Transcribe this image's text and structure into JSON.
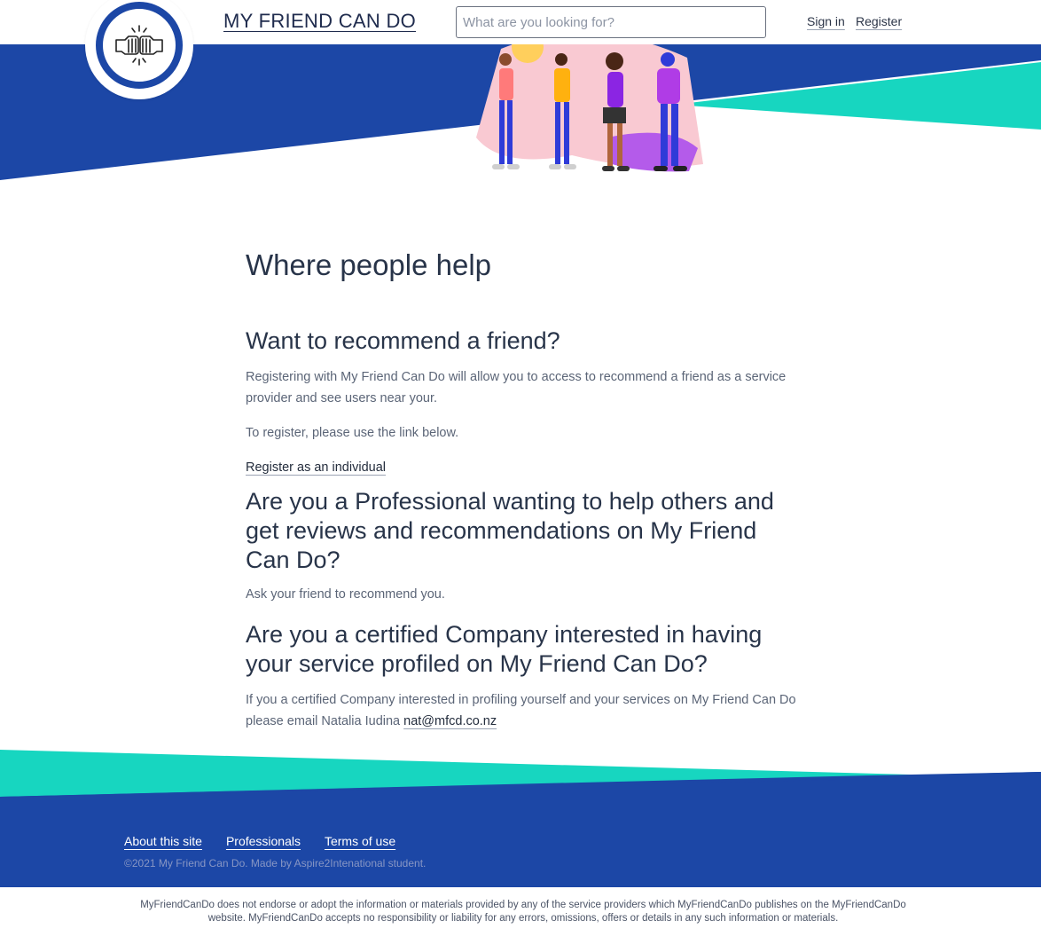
{
  "header": {
    "site_title": "MY FRIEND CAN DO",
    "search_placeholder": "What are you looking for?",
    "sign_in": "Sign in",
    "register": "Register"
  },
  "main": {
    "heading": "Where people help",
    "recommend": {
      "title": "Want to recommend a friend?",
      "paragraph_1": "Registering with My Friend Can Do will allow you to access to recommend a friend as a service provider and see users near your.",
      "paragraph_2": "To register, please use the link below.",
      "link": "Register as an individual"
    },
    "professional": {
      "title": "Are you a Professional wanting to help others and get reviews and recommendations on My Friend Can Do?",
      "paragraph": "Ask your friend to recommend you."
    },
    "company": {
      "title": "Are you a certified Company interested in having your service profiled on My Friend Can Do?",
      "paragraph": "If you a certified Company interested in profiling yourself and your services on My Friend Can Do please email Natalia Iudina",
      "email": "nat@mfcd.co.nz"
    }
  },
  "footer": {
    "links": [
      "About this site",
      "Professionals",
      "Terms of use"
    ],
    "copyright": "©2021 My Friend Can Do. Made by Aspire2Intenational student.",
    "disclaimer": "MyFriendCanDo does not endorse or adopt the information or materials provided by any of the service providers which MyFriendCanDo publishes on the MyFriendCanDo website. MyFriendCanDo accepts no responsibility or liability for any errors, omissions, offers or details in any such information or materials."
  },
  "colors": {
    "brand_blue": "#1c47a6",
    "accent_teal": "#17d6c0",
    "text_dark": "#283449",
    "text_muted": "#5b6577"
  },
  "icons": {
    "logo": "fist-bump-icon",
    "illustration": "people-group-illustration"
  }
}
